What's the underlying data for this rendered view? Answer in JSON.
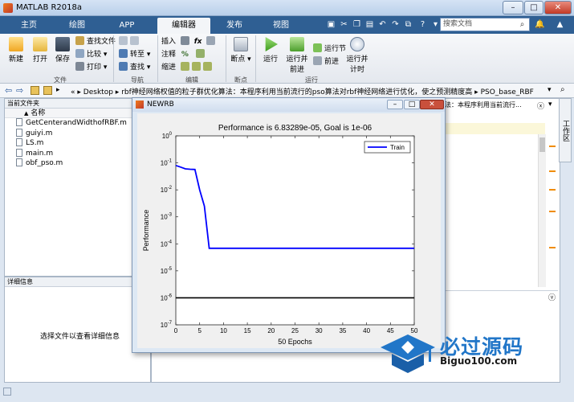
{
  "window": {
    "title": "MATLAB R2018a"
  },
  "tabs": [
    "主页",
    "绘图",
    "APP",
    "编辑器",
    "发布",
    "视图"
  ],
  "search": {
    "placeholder": "搜索文档"
  },
  "ribbon": {
    "file": {
      "new": "新建",
      "open": "打开",
      "save": "保存",
      "find_files": "查找文件",
      "compare": "比较",
      "print": "打印",
      "group": "文件"
    },
    "navigate": {
      "goto": "转至",
      "find": "查找",
      "group": "导航"
    },
    "edit": {
      "insert": "插入",
      "comment": "注释",
      "indent": "缩进",
      "group": "编辑"
    },
    "breakpoints": {
      "label": "断点",
      "group": "断点"
    },
    "run": {
      "run": "运行",
      "run_advance": "运行并前进",
      "run_section": "运行节",
      "advance": "前进",
      "run_time": "运行并计时",
      "group": "运行"
    }
  },
  "address": {
    "prefix": "«",
    "path": [
      "Desktop",
      "rbf神经网络权值的粒子群优化算法：本程序利用当前流行的pso算法对rbf神经网络进行优化，使之预测精度高",
      "PSO_base_RBF"
    ]
  },
  "left_panel": {
    "title": "当前文件夹",
    "column": "名称",
    "column_sort": "▲",
    "files": [
      "GetCenterandWidthofRBF.m",
      "guiyi.m",
      "LS.m",
      "main.m",
      "obf_pso.m"
    ]
  },
  "detail_panel": {
    "title": "详细信息",
    "empty": "选择文件以查看详细信息"
  },
  "right_panel": {
    "tab_text": "法：本程序利用当前流行...",
    "side_tab": "工作区"
  },
  "figure": {
    "title": "NEWRB",
    "chart_title": "Performance is 6.83289e-05, Goal is 1e-06",
    "xlabel": "50 Epochs",
    "ylabel": "Performance",
    "legend": "Train"
  },
  "chart_data": {
    "type": "line",
    "title": "Performance is 6.83289e-05, Goal is 1e-06",
    "xlabel": "50 Epochs",
    "ylabel": "Performance",
    "xlim": [
      0,
      50
    ],
    "ylim_log10": [
      -7,
      0
    ],
    "yscale": "log",
    "xticks": [
      0,
      5,
      10,
      15,
      20,
      25,
      30,
      35,
      40,
      45,
      50
    ],
    "yticks_exp": [
      0,
      -1,
      -2,
      -3,
      -4,
      -5,
      -6,
      -7
    ],
    "legend_position": "top-right",
    "series": [
      {
        "name": "Train",
        "color": "#0000ff",
        "x": [
          0,
          1,
          2,
          3,
          4,
          5,
          6,
          7,
          8,
          9,
          10,
          12,
          14,
          16,
          18,
          20,
          25,
          30,
          35,
          40,
          45,
          50
        ],
        "y": [
          0.08,
          0.07,
          0.06,
          0.058,
          0.057,
          0.01,
          0.0025,
          6.83e-05,
          6.83e-05,
          6.83e-05,
          6.83e-05,
          6.83e-05,
          6.83e-05,
          6.83e-05,
          6.83e-05,
          6.83e-05,
          6.83e-05,
          6.83e-05,
          6.83e-05,
          6.83e-05,
          6.83e-05,
          6.83e-05
        ]
      }
    ],
    "goal": {
      "value": 1e-06,
      "color": "#000000"
    }
  },
  "watermark": {
    "text": "必过源码",
    "sub": "Biguo100.com"
  },
  "colors": {
    "tab_bar": "#2f5f93",
    "accent": "#2176c8"
  }
}
